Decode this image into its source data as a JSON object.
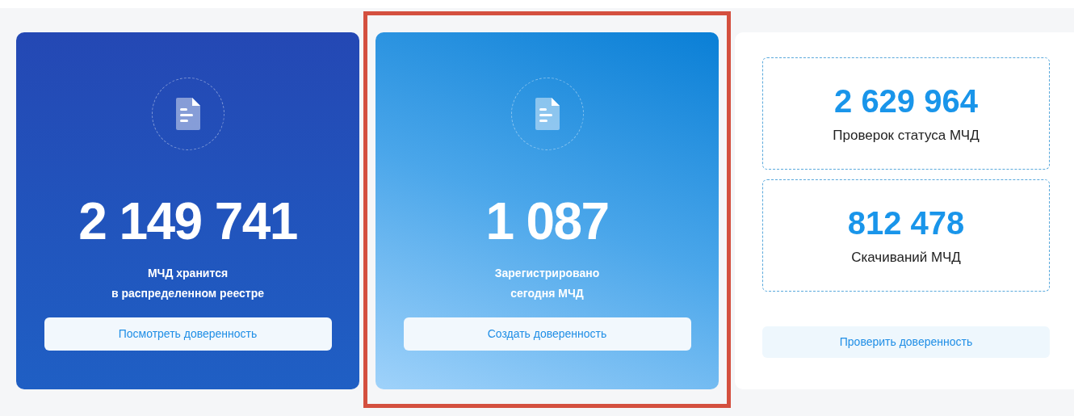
{
  "cards": [
    {
      "kind": "dark",
      "highlighted": false,
      "value": "2 149 741",
      "caption": [
        "МЧД хранится",
        "в распределенном реестре"
      ],
      "button": "Посмотреть доверенность"
    },
    {
      "kind": "light",
      "highlighted": true,
      "value": "1 087",
      "caption": [
        "Зарегистрировано",
        "сегодня МЧД"
      ],
      "button": "Создать доверенность"
    },
    {
      "kind": "stats",
      "highlighted": false,
      "stats": [
        {
          "value": "2 629 964",
          "label": "Проверок статуса МЧД"
        },
        {
          "value": "812 478",
          "label": "Скачиваний МЧД"
        }
      ],
      "button": "Проверить доверенность"
    }
  ]
}
